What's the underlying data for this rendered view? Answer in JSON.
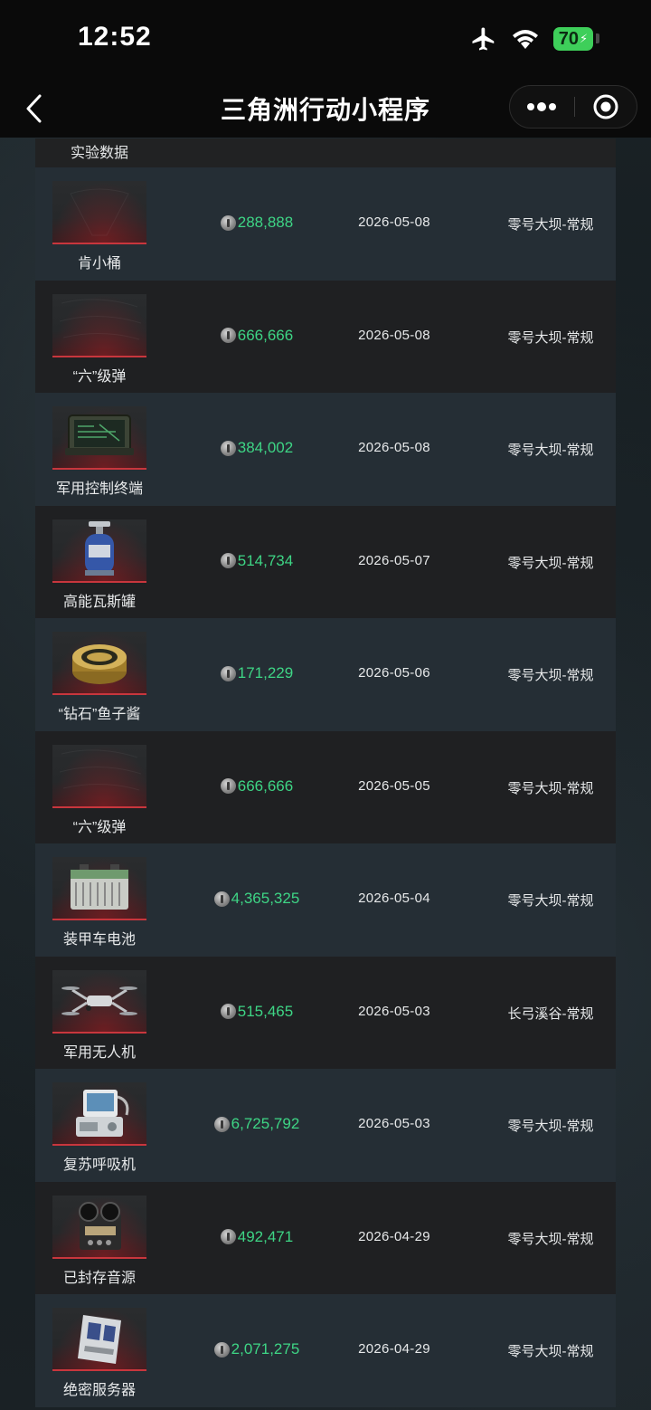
{
  "status_bar": {
    "time": "12:52",
    "battery": "70"
  },
  "nav": {
    "title": "三角洲行动小程序"
  },
  "list": {
    "partial_row_label": "实验数据",
    "rows": [
      {
        "name": "肯小桶",
        "price": "288,888",
        "date": "2026-05-08",
        "map": "零号大坝-常规",
        "icon": "bucket"
      },
      {
        "name": "“六”级弹",
        "price": "666,666",
        "date": "2026-05-08",
        "map": "零号大坝-常规",
        "icon": "ammo"
      },
      {
        "name": "军用控制终端",
        "price": "384,002",
        "date": "2026-05-08",
        "map": "零号大坝-常规",
        "icon": "terminal"
      },
      {
        "name": "高能瓦斯罐",
        "price": "514,734",
        "date": "2026-05-07",
        "map": "零号大坝-常规",
        "icon": "gas-canister"
      },
      {
        "name": "“钻石”鱼子酱",
        "price": "171,229",
        "date": "2026-05-06",
        "map": "零号大坝-常规",
        "icon": "caviar-tin"
      },
      {
        "name": "“六”级弹",
        "price": "666,666",
        "date": "2026-05-05",
        "map": "零号大坝-常规",
        "icon": "ammo"
      },
      {
        "name": "装甲车电池",
        "price": "4,365,325",
        "date": "2026-05-04",
        "map": "零号大坝-常规",
        "icon": "battery-pack"
      },
      {
        "name": "军用无人机",
        "price": "515,465",
        "date": "2026-05-03",
        "map": "长弓溪谷-常规",
        "icon": "drone"
      },
      {
        "name": "复苏呼吸机",
        "price": "6,725,792",
        "date": "2026-05-03",
        "map": "零号大坝-常规",
        "icon": "ventilator"
      },
      {
        "name": "已封存音源",
        "price": "492,471",
        "date": "2026-04-29",
        "map": "零号大坝-常规",
        "icon": "tape-recorder"
      },
      {
        "name": "绝密服务器",
        "price": "2,071,275",
        "date": "2026-04-29",
        "map": "零号大坝-常规",
        "icon": "server"
      }
    ]
  },
  "colors": {
    "price": "#3ed585",
    "row_alt": "#252e35",
    "row_dark": "#1f2022",
    "accent_red": "#c8363d",
    "battery_green": "#3ecf5a"
  }
}
